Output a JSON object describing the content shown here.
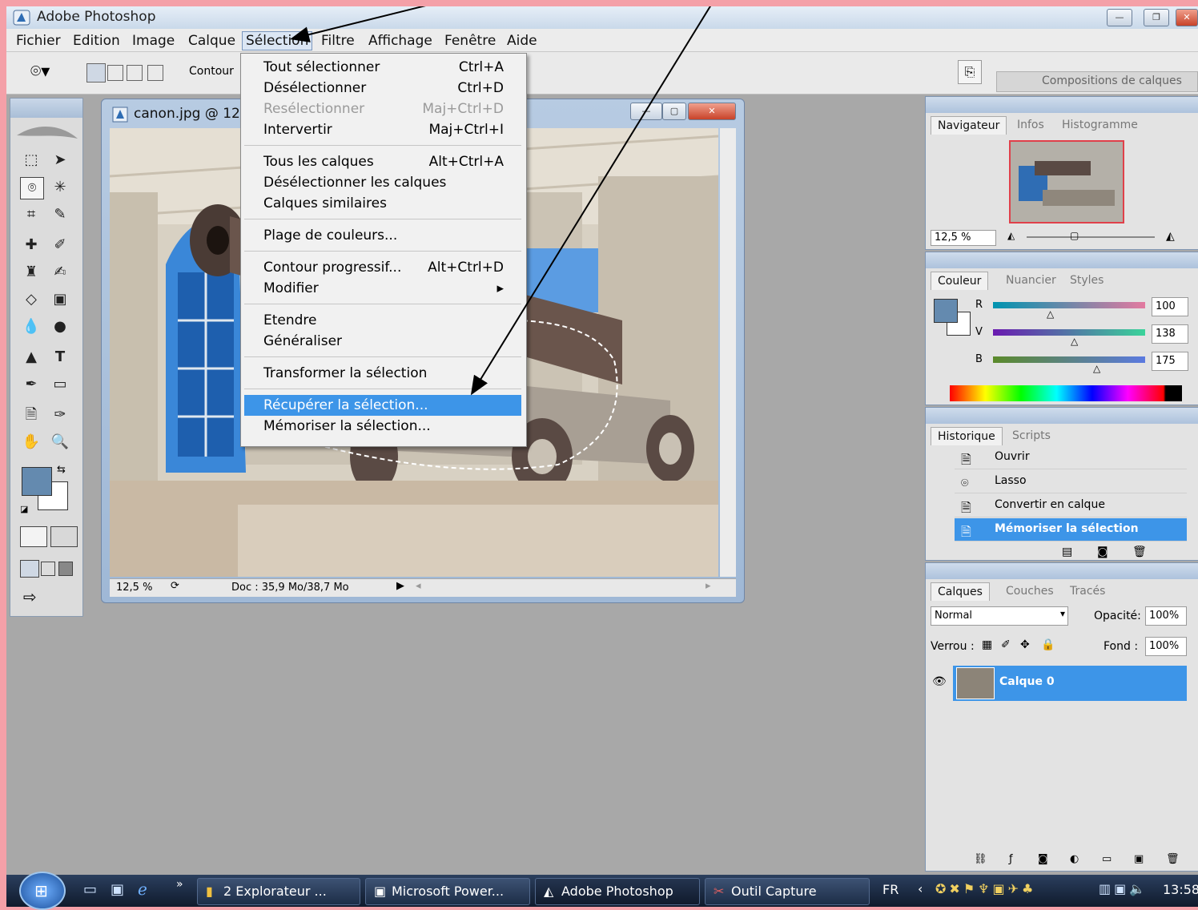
{
  "app": {
    "title": "Adobe Photoshop"
  },
  "menubar": [
    "Fichier",
    "Edition",
    "Image",
    "Calque",
    "Sélection",
    "Filtre",
    "Affichage",
    "Fenêtre",
    "Aide"
  ],
  "optionsbar": {
    "contour_label": "Contour",
    "compositions_label": "Compositions de calques"
  },
  "document": {
    "title": "canon.jpg @ 12,5",
    "zoom": "12,5 %",
    "doc_info": "Doc : 35,9 Mo/38,7 Mo"
  },
  "selection_menu": [
    {
      "label": "Tout sélectionner",
      "shortcut": "Ctrl+A"
    },
    {
      "label": "Désélectionner",
      "shortcut": "Ctrl+D"
    },
    {
      "label": "Resélectionner",
      "shortcut": "Maj+Ctrl+D",
      "disabled": true
    },
    {
      "label": "Intervertir",
      "shortcut": "Maj+Ctrl+I"
    },
    {
      "label": "Tous les calques",
      "shortcut": "Alt+Ctrl+A"
    },
    {
      "label": "Désélectionner les calques",
      "shortcut": ""
    },
    {
      "label": "Calques similaires",
      "shortcut": ""
    },
    {
      "label": "Plage de couleurs...",
      "shortcut": ""
    },
    {
      "label": "Contour progressif...",
      "shortcut": "Alt+Ctrl+D"
    },
    {
      "label": "Modifier",
      "shortcut": "",
      "submenu": true
    },
    {
      "label": "Etendre",
      "shortcut": ""
    },
    {
      "label": "Généraliser",
      "shortcut": ""
    },
    {
      "label": "Transformer la sélection",
      "shortcut": ""
    },
    {
      "label": "Récupérer la sélection...",
      "shortcut": "",
      "highlighted": true
    },
    {
      "label": "Mémoriser la sélection...",
      "shortcut": ""
    }
  ],
  "navigator": {
    "tabs": [
      "Navigateur",
      "Infos",
      "Histogramme"
    ],
    "zoom": "12,5 %"
  },
  "color": {
    "tabs": [
      "Couleur",
      "Nuancier",
      "Styles"
    ],
    "r_label": "R",
    "v_label": "V",
    "b_label": "B",
    "r": "100",
    "v": "138",
    "b": "175",
    "foreground": "#648aaf"
  },
  "history": {
    "tabs": [
      "Historique",
      "Scripts"
    ],
    "items": [
      "Ouvrir",
      "Lasso",
      "Convertir en calque",
      "Mémoriser la sélection"
    ]
  },
  "layers": {
    "tabs": [
      "Calques",
      "Couches",
      "Tracés"
    ],
    "blend_mode": "Normal",
    "opacity_label": "Opacité:",
    "opacity": "100%",
    "lock_label": "Verrou :",
    "fill_label": "Fond :",
    "fill": "100%",
    "layer_name": "Calque 0"
  },
  "taskbar": {
    "items": [
      "2 Explorateur ...",
      "Microsoft Power...",
      "Adobe Photoshop",
      "Outil Capture"
    ],
    "lang": "FR",
    "clock": "13:58"
  }
}
